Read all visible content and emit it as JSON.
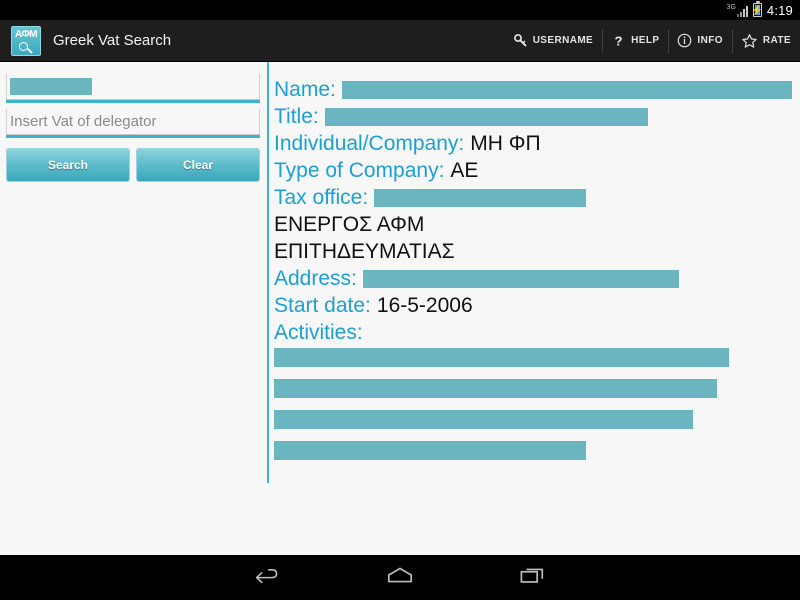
{
  "status_bar": {
    "network_label": "3G",
    "time": "4:19",
    "signal_icon": "signal-bars-icon",
    "battery_icon": "battery-charging-icon"
  },
  "action_bar": {
    "app_icon": "afm-search-app-icon",
    "app_icon_text": "ΑΦΜ",
    "title": "Greek Vat Search",
    "actions": [
      {
        "label": "USERNAME",
        "icon": "key-icon"
      },
      {
        "label": "HELP",
        "icon": "question-mark-icon"
      },
      {
        "label": "INFO",
        "icon": "info-circle-icon"
      },
      {
        "label": "RATE",
        "icon": "star-outline-icon"
      }
    ]
  },
  "left_panel": {
    "vat_field": {
      "value": "",
      "placeholder": "",
      "redacted": true,
      "redacted_width": 82
    },
    "delegator_field": {
      "value": "",
      "placeholder": "Insert Vat of delegator"
    },
    "search_button": "Search",
    "clear_button": "Clear"
  },
  "result": {
    "fields": [
      {
        "label": "Name:",
        "value": "",
        "redacted": true,
        "redacted_width": 450
      },
      {
        "label": "Title:",
        "value": "",
        "redacted": true,
        "redacted_width": 323
      },
      {
        "label": "Individual/Company:",
        "value": "ΜΗ ΦΠ",
        "redacted": false
      },
      {
        "label": "Type of Company:",
        "value": "ΑΕ",
        "redacted": false
      },
      {
        "label": "Tax office:",
        "value": "",
        "redacted": true,
        "redacted_width": 212
      }
    ],
    "status_lines": [
      "ΕΝΕΡΓΟΣ ΑΦΜ",
      "ΕΠΙΤΗΔΕΥΜΑΤΙΑΣ"
    ],
    "address": {
      "label": "Address:",
      "value": "",
      "redacted": true,
      "redacted_width": 316
    },
    "start_date": {
      "label": "Start date:",
      "value": "16-5-2006",
      "redacted": false
    },
    "activities": {
      "label": "Activities:",
      "items": [
        {
          "value": "",
          "redacted": true,
          "redacted_width": 455
        },
        {
          "value": "",
          "redacted": true,
          "redacted_width": 443
        },
        {
          "value": "",
          "redacted": true,
          "redacted_width": 419
        },
        {
          "value": "",
          "redacted": true,
          "redacted_width": 312
        }
      ]
    }
  },
  "nav_bar": {
    "back": "back-icon",
    "home": "home-icon",
    "recents": "recents-icon"
  },
  "colors": {
    "accent_teal": "#3fb2cd",
    "label_blue": "#1d9fd2",
    "redaction": "#6bb5c1",
    "action_bar": "#1e1e1e",
    "page_bg": "#f7f7f7"
  }
}
